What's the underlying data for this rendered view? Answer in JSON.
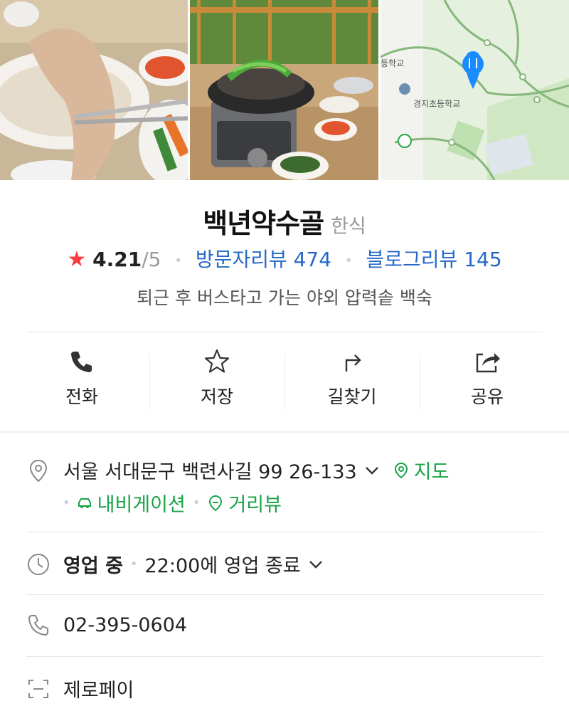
{
  "gallery": {
    "photos": [
      "food-photo",
      "bbq-table-photo",
      "map-thumbnail"
    ],
    "map_labels": [
      "등학교",
      "경지초등학교"
    ]
  },
  "place": {
    "name": "백년약수골",
    "category": "한식",
    "rating": "4.21",
    "rating_max": "/5",
    "visitor_reviews_label": "방문자리뷰 474",
    "blog_reviews_label": "블로그리뷰 145",
    "description": "퇴근 후 버스타고 가는 야외 압력솥 백숙"
  },
  "actions": [
    {
      "label": "전화",
      "icon": "phone-icon"
    },
    {
      "label": "저장",
      "icon": "star-outline-icon"
    },
    {
      "label": "길찾기",
      "icon": "directions-icon"
    },
    {
      "label": "공유",
      "icon": "share-icon"
    }
  ],
  "address": {
    "text": "서울 서대문구 백련사길 99 26-133",
    "map_link": "지도",
    "navigation_link": "내비게이션",
    "streetview_link": "거리뷰"
  },
  "hours": {
    "status": "영업 중",
    "detail": "22:00에 영업 종료"
  },
  "phone": {
    "number": "02-395-0604"
  },
  "payment": {
    "label": "제로페이"
  },
  "colors": {
    "accent_green": "#18a346",
    "link_blue": "#2568c8",
    "star_red": "#ff3b3b",
    "map_pin_blue": "#1a8cff"
  }
}
